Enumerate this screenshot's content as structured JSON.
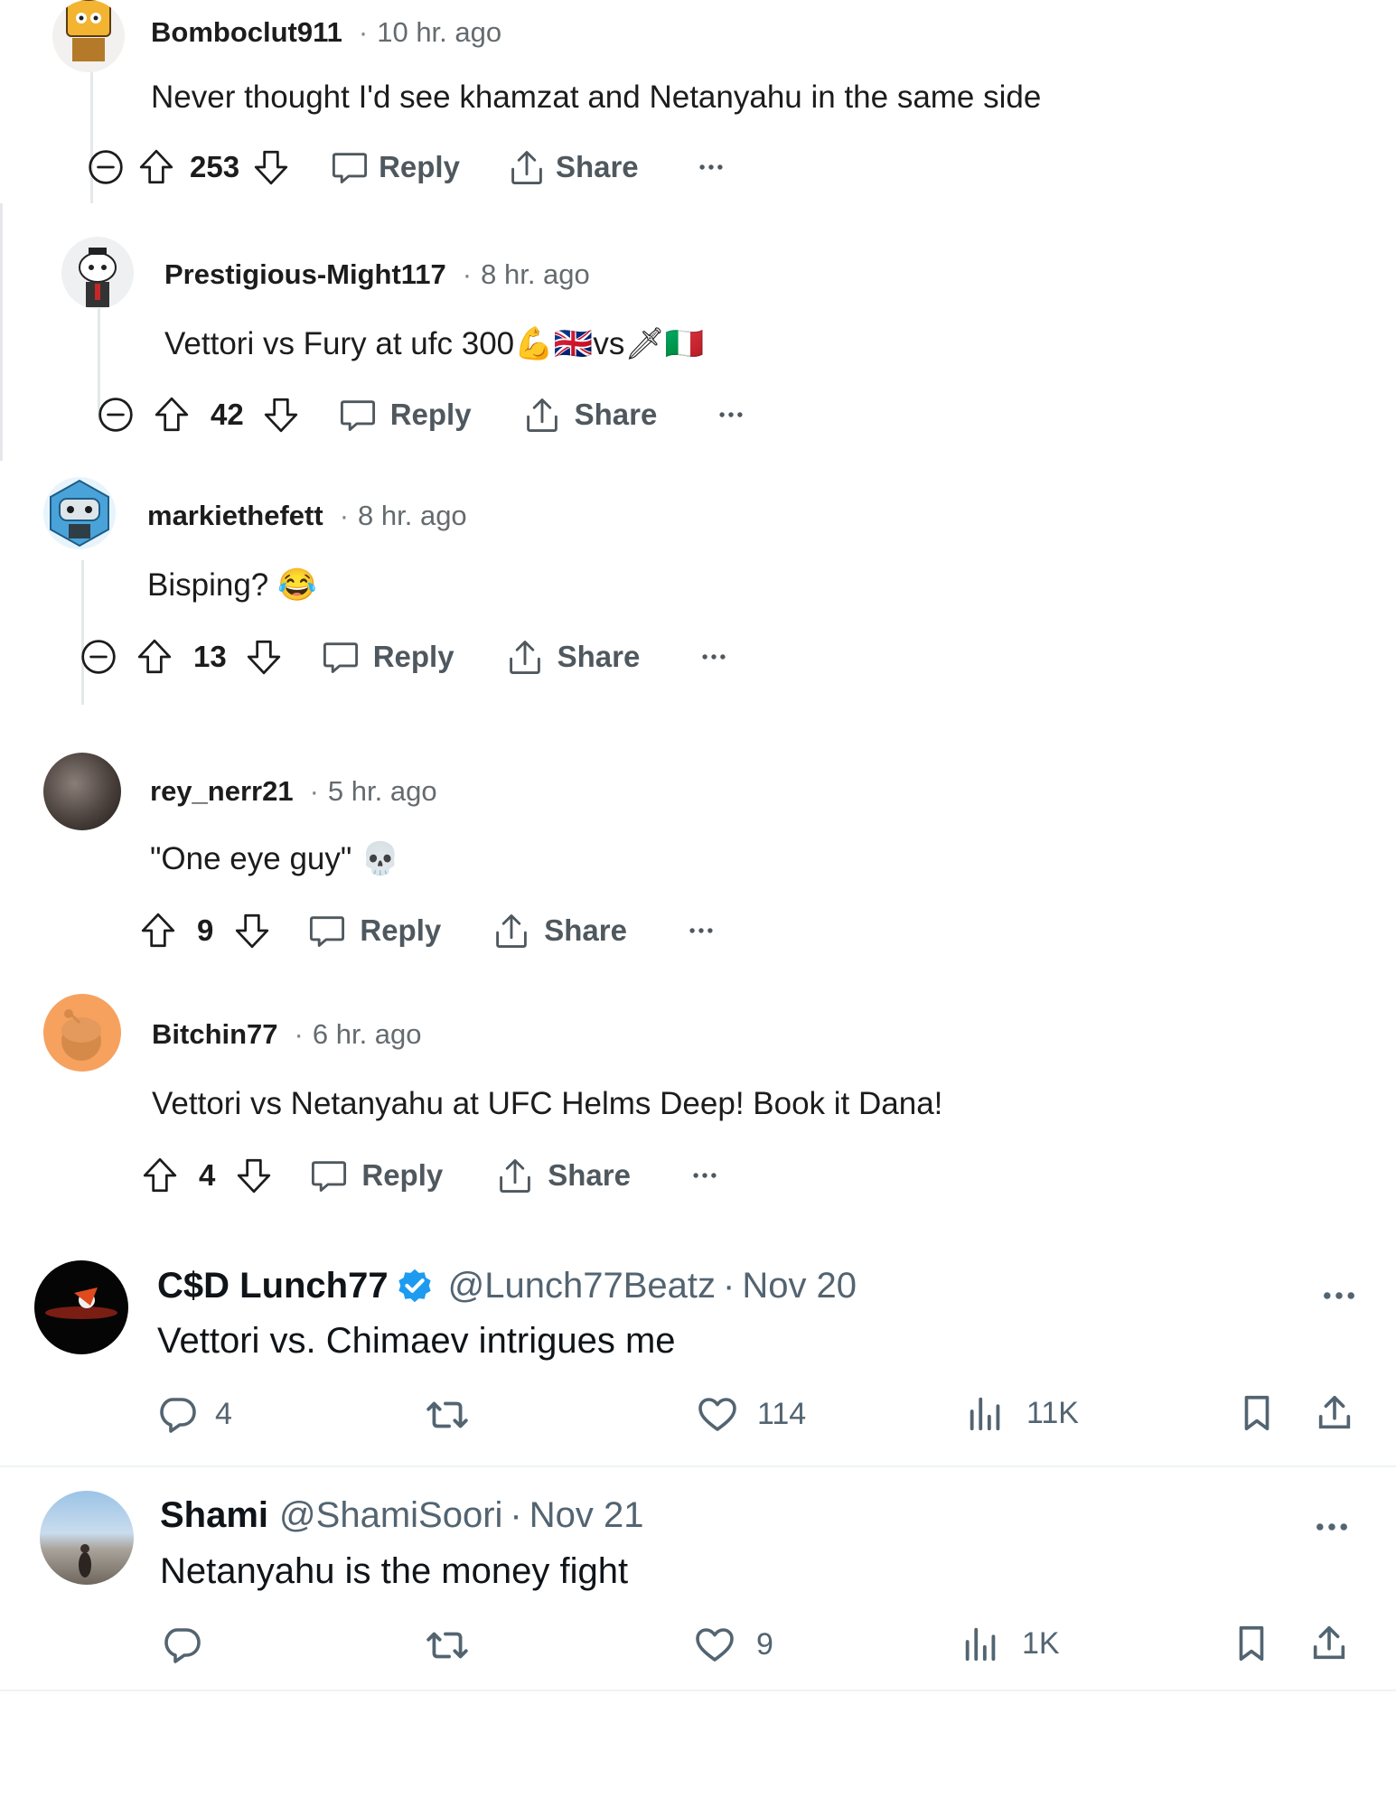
{
  "reddit": {
    "actions": {
      "reply": "Reply",
      "share": "Share"
    },
    "comments": [
      {
        "user": "Bomboclut911",
        "time": "10 hr. ago",
        "text": "Never thought I'd see khamzat and Netanyahu in the same side",
        "score": "253"
      },
      {
        "user": "Prestigious-Might117",
        "time": "8 hr. ago",
        "text": "Vettori vs Fury at ufc 300",
        "emoji_a": "💪",
        "emoji_b": "🇬🇧",
        "mid": "vs",
        "emoji_c": "🗡",
        "emoji_d": "🇮🇹",
        "score": "42"
      },
      {
        "user": "markiethefett",
        "time": "8 hr. ago",
        "text": "Bisping?",
        "emoji": "😂",
        "score": "13"
      },
      {
        "user": "rey_nerr21",
        "time": "5 hr. ago",
        "text": "\"One eye guy\"",
        "emoji": "💀",
        "score": "9"
      },
      {
        "user": "Bitchin77",
        "time": "6 hr. ago",
        "text": "Vettori vs Netanyahu at UFC Helms Deep! Book it Dana!",
        "score": "4"
      }
    ]
  },
  "x_posts": [
    {
      "name": "C$D Lunch77",
      "handle": "@Lunch77Beatz",
      "date": "Nov 20",
      "verified": true,
      "text": "Vettori vs. Chimaev intrigues me",
      "replies": "4",
      "retweets": "",
      "likes": "114",
      "views": "11K"
    },
    {
      "name": "Shami",
      "handle": "@ShamiSoori",
      "date": "Nov 21",
      "verified": false,
      "text": "Netanyahu is the money fight",
      "replies": "",
      "retweets": "",
      "likes": "9",
      "views": "1K"
    }
  ],
  "x_sep": "·",
  "colors": {
    "verified": "#1d9bf0",
    "reddit_meta": "#646b6f",
    "x_meta": "#536471"
  }
}
